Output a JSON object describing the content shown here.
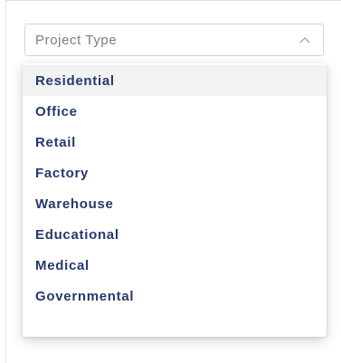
{
  "select": {
    "value": "Project Type",
    "icon": "chevron-up-icon",
    "expanded": true
  },
  "options": [
    {
      "label": "Residential",
      "highlighted": true
    },
    {
      "label": "Office"
    },
    {
      "label": "Retail"
    },
    {
      "label": "Factory"
    },
    {
      "label": "Warehouse"
    },
    {
      "label": "Educational"
    },
    {
      "label": "Medical"
    },
    {
      "label": "Governmental"
    }
  ],
  "colors": {
    "option_text": "#25396b",
    "placeholder_text": "#7d7d7d",
    "highlight_bg": "#f2f2f2",
    "border": "#d6d6d6"
  }
}
